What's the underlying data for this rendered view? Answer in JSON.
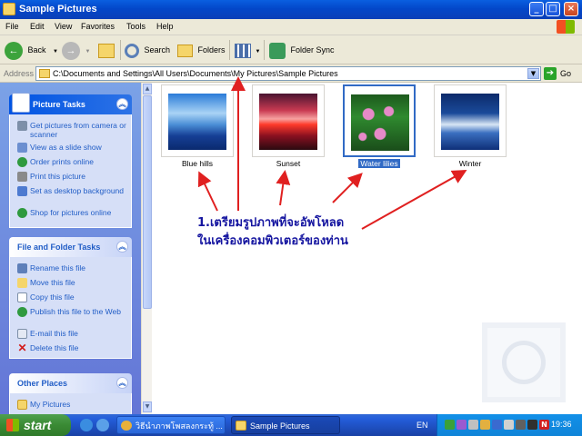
{
  "window": {
    "title": "Sample Pictures"
  },
  "menu": [
    "File",
    "Edit",
    "View",
    "Favorites",
    "Tools",
    "Help"
  ],
  "toolbar": {
    "back": "Back",
    "search": "Search",
    "folders": "Folders",
    "folder_sync": "Folder Sync"
  },
  "address": {
    "label": "Address",
    "path": "C:\\Documents and Settings\\All Users\\Documents\\My Pictures\\Sample Pictures",
    "go": "Go"
  },
  "picture_tasks": {
    "title": "Picture Tasks",
    "items": [
      {
        "label": "Get pictures from camera or scanner",
        "icon": "camera-icon"
      },
      {
        "label": "View as a slide show",
        "icon": "slideshow-icon"
      },
      {
        "label": "Order prints online",
        "icon": "globe-icon"
      },
      {
        "label": "Print this picture",
        "icon": "printer-icon"
      },
      {
        "label": "Set as desktop background",
        "icon": "desktop-icon"
      },
      {
        "label": "Shop for pictures online",
        "icon": "globe-icon"
      }
    ]
  },
  "file_folder_tasks": {
    "title": "File and Folder Tasks",
    "items": [
      {
        "label": "Rename this file",
        "icon": "rename-icon"
      },
      {
        "label": "Move this file",
        "icon": "move-icon"
      },
      {
        "label": "Copy this file",
        "icon": "copy-icon"
      },
      {
        "label": "Publish this file to the Web",
        "icon": "publish-icon"
      },
      {
        "label": "E-mail this file",
        "icon": "email-icon"
      },
      {
        "label": "Delete this file",
        "icon": "delete-icon"
      }
    ]
  },
  "other_places": {
    "title": "Other Places",
    "items": [
      {
        "label": "My Pictures",
        "icon": "folder-icon"
      }
    ]
  },
  "files": [
    {
      "name": "Blue hills",
      "selected": false
    },
    {
      "name": "Sunset",
      "selected": false
    },
    {
      "name": "Water lilies",
      "selected": true
    },
    {
      "name": "Winter",
      "selected": false
    }
  ],
  "annotation": {
    "line1": "1.เตรียมรูปภาพที่จะอัพโหลด",
    "line2": "ในเครื่องคอมพิวเตอร์ของท่าน"
  },
  "taskbar": {
    "start": "start",
    "tasks": [
      {
        "label": "วิธีนำภาพโพสลงกระทู้ ..."
      },
      {
        "label": "Sample Pictures"
      }
    ],
    "lang": "EN",
    "clock": "19:36"
  },
  "colors": {
    "xp_blue": "#0347c9",
    "selection": "#316ac5",
    "annotation_blue": "#1515a0",
    "arrow_red": "#e02020",
    "taskbar_green": "#3a8a34"
  }
}
